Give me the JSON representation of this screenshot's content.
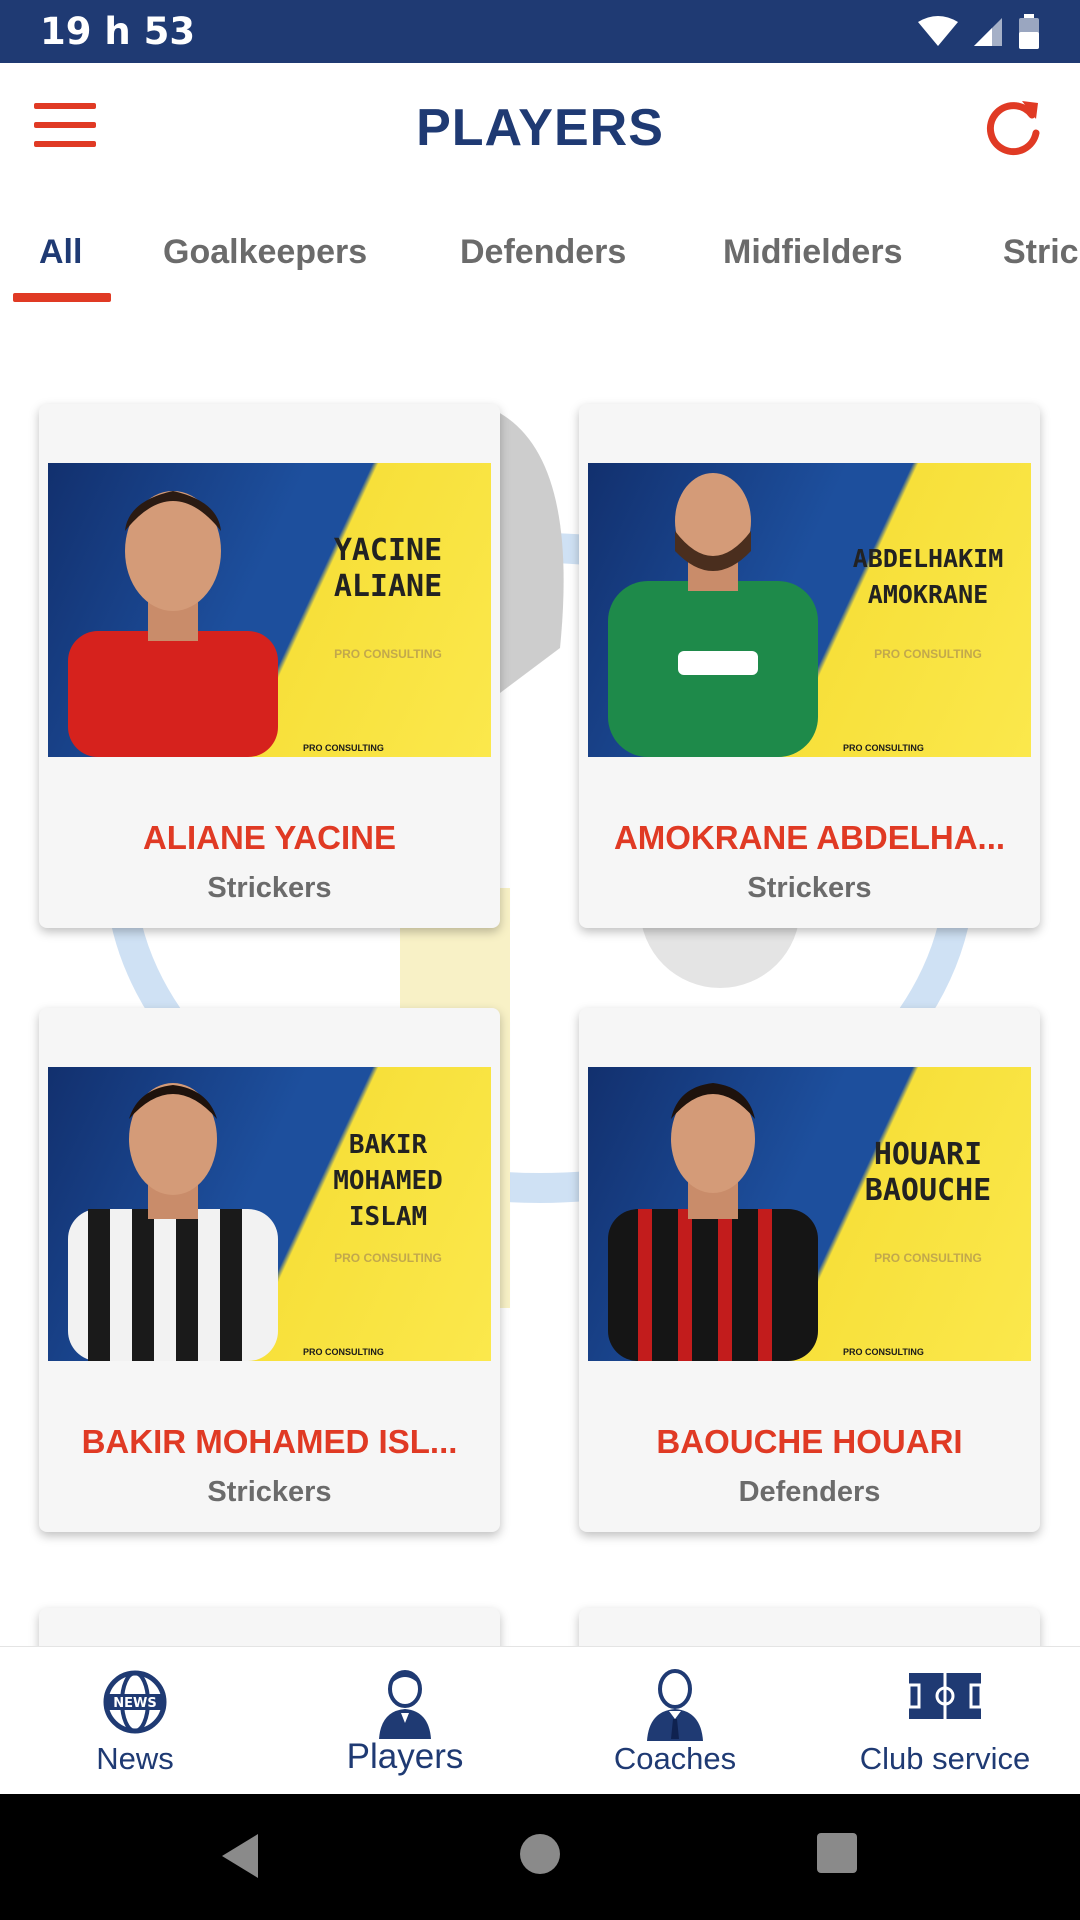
{
  "status_bar": {
    "time": "19 h 53"
  },
  "header": {
    "title": "PLAYERS"
  },
  "tabs": [
    {
      "label": "All",
      "active": true
    },
    {
      "label": "Goalkeepers"
    },
    {
      "label": "Defenders"
    },
    {
      "label": "Midfielders"
    },
    {
      "label": "Stric"
    }
  ],
  "players": [
    {
      "name": "ALIANE YACINE",
      "position": "Strickers",
      "poster_name": "YACINE ALIANE",
      "jersey_color": "#d6221d"
    },
    {
      "name": "AMOKRANE ABDELHA...",
      "position": "Strickers",
      "poster_name": "ABDELHAKIM AMOKRANE",
      "jersey_color": "#1e8a4a"
    },
    {
      "name": "BAKIR MOHAMED ISL...",
      "position": "Strickers",
      "poster_name": "BAKIR MOHAMED ISLAM",
      "jersey_color": "#222222"
    },
    {
      "name": "BAOUCHE HOUARI",
      "position": "Defenders",
      "poster_name": "HOUARI BAOUCHE",
      "jersey_color": "#b31a1a"
    }
  ],
  "poster": {
    "brand": "PRO CONSULTING",
    "foot": "PRO CONSULTING"
  },
  "bottom_nav": [
    {
      "label": "News",
      "icon": "news-globe-icon"
    },
    {
      "label": "Players",
      "icon": "player-icon",
      "active": true
    },
    {
      "label": "Coaches",
      "icon": "coach-icon"
    },
    {
      "label": "Club service",
      "icon": "field-icon"
    }
  ],
  "colors": {
    "primary": "#1f3a73",
    "accent": "#e03a24",
    "muted": "#6b6b6b"
  }
}
